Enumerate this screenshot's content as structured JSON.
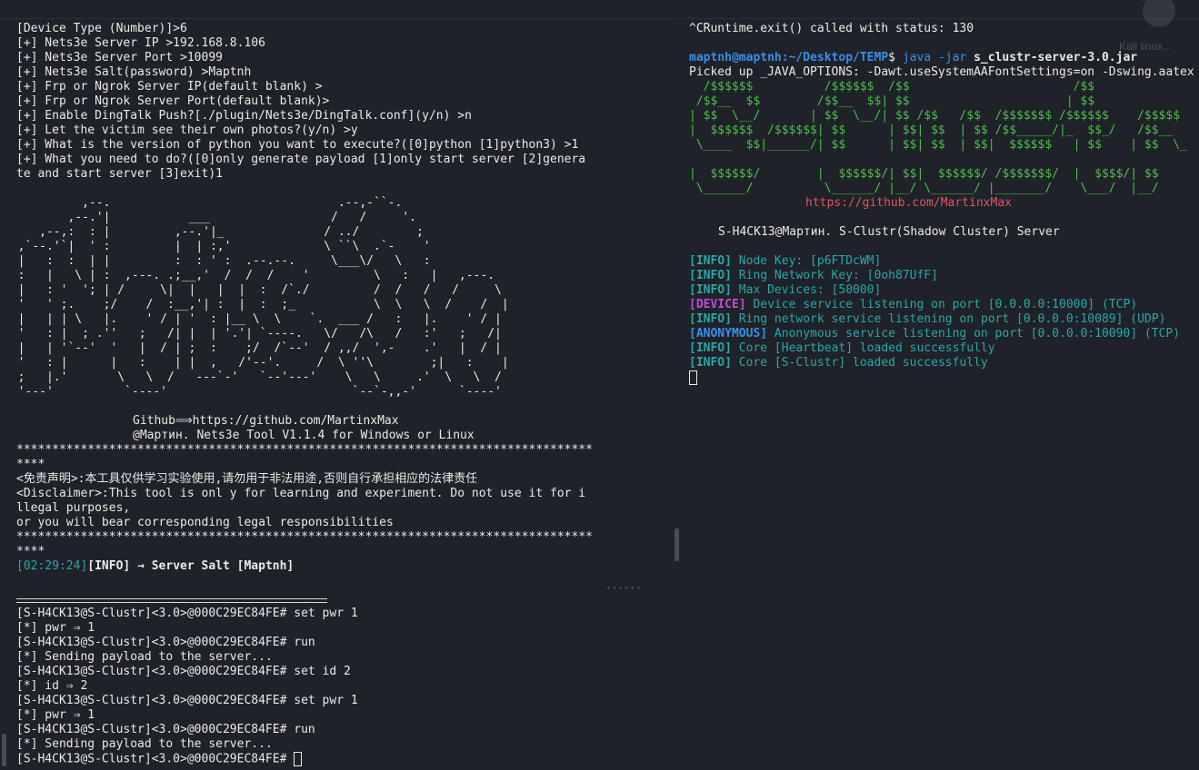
{
  "left": {
    "config_lines": [
      "[Device Type (Number)]>6",
      "[+] Nets3e Server IP >192.168.8.106",
      "[+] Nets3e Server Port >10099",
      "[+] Nets3e Salt(password) >Maptnh",
      "[+] Frp or Ngrok Server IP(default blank) >",
      "[+] Frp or Ngrok Server Port(default blank)>",
      "[+] Enable DingTalk Push?[./plugin/Nets3e/DingTalk.conf](y/n) >n",
      "[+] Let the victim see their own photos?(y/n) >y",
      "[+] What is the version of python you want to execute?([0]python [1]python3) >1",
      "[+] What you need to do?([0]only generate payload [1]only start server [2]genera",
      "te and start server [3]exit)1"
    ],
    "ascii_logo": "           ,--.                                .--,-``-.\n         ,--.'|           ___                 /   /     '.\n     ,--,:  : |         ,--.'|_              / ../        ;\n  ,`--.'`|  ' :         |  | :,'             \\ ``\\  .`-    '\n  |   :  :  | |         :  : ' :  .--.--.     \\___\\/   \\   :\n  :   |   \\ | :  ,---. .;__,'  /  /  /    '         \\   :   |   ,---.\n  |   : '  '; | /     \\|  |   |  |  :  /`./         /  /   /   /     \\\n  '   ' ;.    ;/    /  :__,'| :  |  :  ;_           \\  \\   \\  /    /  |\n  |   | | \\   |.    ' / | '  : |__ \\  \\    `.  ___ /   :   |.    ' / |\n  '   : |  ; .''   ;   /| |  | '.'| `----.   \\/   /\\   /   :'   ;   /|\n  |   | '`--'  '   |  / | ;  :    ;/  /`--'  / ,,/  ',-    .'   |  / |\n  '   : |      |   :    | |  ,   /'--'.     /  \\ ''\\        ;|   :    |\n  ;   |.'       \\   \\  /   ---`-'   `--'---'    \\   \\     .'  \\   \\  /\n  '---'          `----'                          `--`-,,-'      `----'",
    "github_line": "Github⟹https://github.com/MartinxMax",
    "tool_line": "@Мартин. Nets3e Tool V1.1.4 for Windows or Linux",
    "stars_1": "*********************************************************************************",
    "stars_1b": "****",
    "disclaimer_cn": "<免责声明>:本工具仅供学习实验使用,请勿用于非法用途,否则自行承担相应的法律责任",
    "disclaimer_en_1": "<Disclaimer>:This tool is onl y for learning and experiment. Do not use it for i",
    "disclaimer_en_2": "llegal purposes,",
    "disclaimer_en_3": "or you will bear corresponding legal responsibilities",
    "stars_2": "*********************************************************************************",
    "stars_2b": "****",
    "salt_ts": "[02:29:24]",
    "salt_info": "[INFO] → Server Salt [Maptnh]",
    "dots": "......",
    "session_lines": [
      "[S-H4CK13@S-Clustr]<3.0>@000C29EC84FE# set pwr 1",
      "[*] pwr ⇒ 1",
      "[S-H4CK13@S-Clustr]<3.0>@000C29EC84FE# run",
      "[*] Sending payload to the server...",
      "[S-H4CK13@S-Clustr]<3.0>@000C29EC84FE# set id 2",
      "[*] id ⇒ 2",
      "[S-H4CK13@S-Clustr]<3.0>@000C29EC84FE# set pwr 1",
      "[*] pwr ⇒ 1",
      "[S-H4CK13@S-Clustr]<3.0>@000C29EC84FE# run",
      "[*] Sending payload to the server...",
      "[S-H4CK13@S-Clustr]<3.0>@000C29EC84FE# "
    ]
  },
  "right": {
    "exit_line": "^CRuntime.exit() called with status: 130",
    "prompt_user": "maptnh@maptnh",
    "prompt_path": ":~/Desktop/TEMP",
    "prompt_dollar": "$ ",
    "cmd_java": "java -jar ",
    "cmd_jar": "s_clustr-server-3.0.jar",
    "java_options": "Picked up _JAVA_OPTIONS: -Dawt.useSystemAAFontSettings=on -Dswing.aatex",
    "banner_art": "  /$$$$$$          /$$$$$$  /$$                       /$$\n /$$__  $$        /$$__  $$| $$                      | $$\n| $$  \\__/       | $$  \\__/| $$ /$$   /$$  /$$$$$$$ /$$$$$$    /$$$$$\n|  $$$$$$  /$$$$$$| $$      | $$| $$  | $$ /$$_____/|_  $$_/   /$$__\n \\____  $$|______/| $$      | $$| $$  | $$|  $$$$$$   | $$    | $$  \\_\n\n|  $$$$$$/        |  $$$$$$/| $$|  $$$$$$/ /$$$$$$$/  |  $$$$/| $$\n \\______/          \\______/ |__/ \\______/ |_______/    \\___/  |__/",
    "github_url": "https://github.com/MartinxMax",
    "server_title": "S-H4CK13@Мартин. S-Clustr(Shadow Cluster) Server",
    "log": [
      {
        "tag": "[INFO]",
        "kind": "info",
        "text": " Node Key: [p6FTDcWM]"
      },
      {
        "tag": "[INFO]",
        "kind": "info",
        "text": " Ring Network Key: [0oh87UfF]"
      },
      {
        "tag": "[INFO]",
        "kind": "info",
        "text": " Max Devices: [50000]"
      },
      {
        "tag": "[DEVICE]",
        "kind": "device",
        "text": " Device service listening on port [0.0.0.0:10000] (TCP)"
      },
      {
        "tag": "[INFO]",
        "kind": "info",
        "text": " Ring network service listening on port [0.0.0.0:10089] (UDP)"
      },
      {
        "tag": "[ANONYMOUS]",
        "kind": "anon",
        "text": " Anonymous service listening on port [0.0.0.0:10090] (TCP)"
      },
      {
        "tag": "[INFO]",
        "kind": "info",
        "text": " Core [Heartbeat] loaded successfully"
      },
      {
        "tag": "[INFO]",
        "kind": "info",
        "text": " Core [S-Clustr] loaded successfully"
      }
    ],
    "watermark_text": "Kali linux..."
  },
  "colors": {
    "background": "#1f2229",
    "text": "#eaeaea",
    "teal": "#2aa7a6",
    "blue": "#3b8eea",
    "magenta": "#c14bd6",
    "green": "#4bc14b",
    "red": "#e05561"
  }
}
